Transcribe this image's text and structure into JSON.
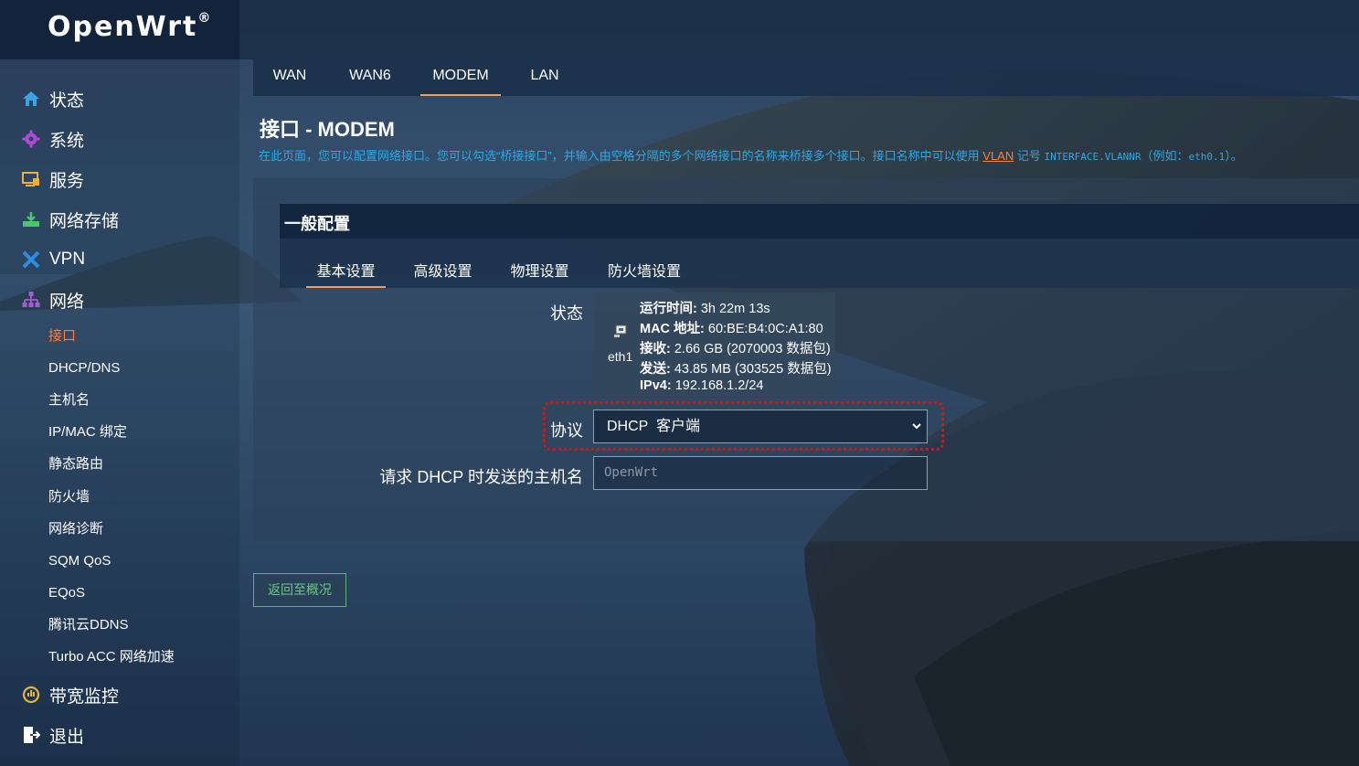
{
  "brand": {
    "name": "OpenWrt",
    "mark": "®"
  },
  "sidebar": {
    "items": [
      {
        "label": "状态",
        "icon": "home-icon"
      },
      {
        "label": "系统",
        "icon": "gear-icon"
      },
      {
        "label": "服务",
        "icon": "services-icon"
      },
      {
        "label": "网络存储",
        "icon": "storage-icon"
      },
      {
        "label": "VPN",
        "icon": "vpn-icon"
      },
      {
        "label": "网络",
        "icon": "network-icon"
      },
      {
        "label": "带宽监控",
        "icon": "bandwidth-icon"
      },
      {
        "label": "退出",
        "icon": "logout-icon"
      }
    ],
    "network_sub": [
      {
        "label": "接口",
        "active": true
      },
      {
        "label": "DHCP/DNS"
      },
      {
        "label": "主机名"
      },
      {
        "label": "IP/MAC 绑定"
      },
      {
        "label": "静态路由"
      },
      {
        "label": "防火墙"
      },
      {
        "label": "网络诊断"
      },
      {
        "label": "SQM QoS"
      },
      {
        "label": "EQoS"
      },
      {
        "label": "腾讯云DDNS"
      },
      {
        "label": "Turbo ACC 网络加速"
      }
    ]
  },
  "top_tabs": [
    {
      "label": "WAN"
    },
    {
      "label": "WAN6"
    },
    {
      "label": "MODEM",
      "active": true
    },
    {
      "label": "LAN"
    }
  ],
  "page": {
    "title": "接口 - MODEM",
    "desc_before": "在此页面，您可以配置网络接口。您可以勾选“桥接接口”，并输入由空格分隔的多个网络接口的名称来桥接多个接口。接口名称中可以使用 ",
    "desc_link": "VLAN",
    "desc_middle": " 记号 ",
    "desc_code1": "INTERFACE.VLANNR",
    "desc_after1": "（例如：",
    "desc_code2": "eth0.1",
    "desc_after2": "）。"
  },
  "section": {
    "title": "一般配置",
    "tabs": [
      {
        "label": "基本设置",
        "active": true
      },
      {
        "label": "高级设置"
      },
      {
        "label": "物理设置"
      },
      {
        "label": "防火墙设置"
      }
    ]
  },
  "status": {
    "label": "状态",
    "device": "eth1",
    "lines": [
      {
        "key": "运行时间:",
        "value": " 3h 22m 13s"
      },
      {
        "key": "MAC 地址:",
        "value": " 60:BE:B4:0C:A1:80"
      },
      {
        "key": "接收:",
        "value": " 2.66 GB (2070003 数据包)"
      },
      {
        "key": "发送:",
        "value": " 43.85 MB (303525 数据包)"
      },
      {
        "key": "IPv4:",
        "value": " 192.168.1.2/24"
      }
    ]
  },
  "protocol": {
    "label": "协议",
    "value": "DHCP  客户端"
  },
  "hostname": {
    "label": "请求 DHCP 时发送的主机名",
    "placeholder": "OpenWrt"
  },
  "back_button": "返回至概况",
  "colors": {
    "accent": "#ff7e33",
    "link": "#2ea7e8",
    "highlight": "#cc1a1a",
    "button": "#6fc489"
  }
}
